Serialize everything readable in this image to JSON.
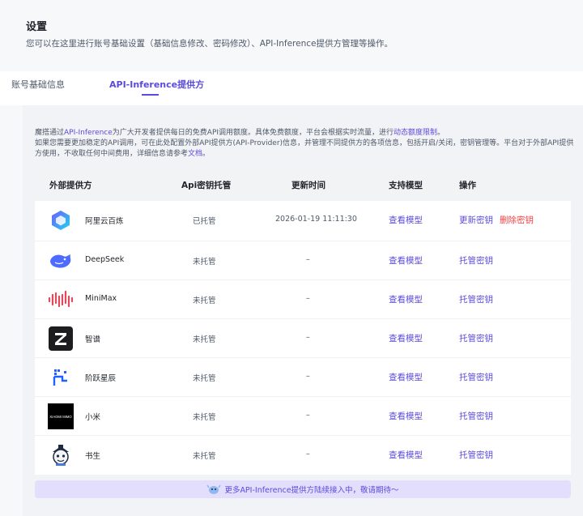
{
  "header": {
    "title": "设置",
    "description": "您可以在这里进行账号基础设置（基础信息修改、密码修改）、API-Inference提供方管理等操作。"
  },
  "tabs": [
    {
      "label": "账号基础信息",
      "active": false
    },
    {
      "label": "API-Inference提供方",
      "active": true
    }
  ],
  "intro": {
    "l1_a": "魔搭通过",
    "l1_link": "API-Inference",
    "l1_b": "为广大开发者提供每日的免费API调用额度。具体免费额度，平台会根据实时流量，进行",
    "l1_link2": "动态额度限制",
    "l1_c": "。",
    "l2": "如果您需要更加稳定的API调用，可在此处配置外部API提供方(API-Provider)信息，并管理不同提供方的各项信息，包括开启/关闭，密钥管理等。平台对于外部API提供方使用，不收取任何中间费用，详细信息请参考",
    "l2_link": "文档",
    "l2_end": "。"
  },
  "table": {
    "headers": [
      "外部提供方",
      "Api密钥托管",
      "更新时间",
      "支持模型",
      "操作"
    ],
    "rows": [
      {
        "provider": "阿里云百炼",
        "logo": "aliyun-bailian-icon",
        "status": "已托管",
        "updated": "2026-01-19 11:11:30",
        "model_link": "查看模型",
        "actions": [
          "更新密钥",
          "删除密钥"
        ]
      },
      {
        "provider": "DeepSeek",
        "logo": "deepseek-whale-icon",
        "status": "未托管",
        "updated": "–",
        "model_link": "查看模型",
        "actions": [
          "托管密钥"
        ]
      },
      {
        "provider": "MiniMax",
        "logo": "minimax-wave-icon",
        "status": "未托管",
        "updated": "–",
        "model_link": "查看模型",
        "actions": [
          "托管密钥"
        ]
      },
      {
        "provider": "智谱",
        "logo": "zhipu-z-icon",
        "status": "未托管",
        "updated": "–",
        "model_link": "查看模型",
        "actions": [
          "托管密钥"
        ]
      },
      {
        "provider": "阶跃星辰",
        "logo": "stepfun-icon",
        "status": "未托管",
        "updated": "–",
        "model_link": "查看模型",
        "actions": [
          "托管密钥"
        ]
      },
      {
        "provider": "小米",
        "logo": "xiaomi-mimo-icon",
        "status": "未托管",
        "updated": "–",
        "model_link": "查看模型",
        "actions": [
          "托管密钥"
        ]
      },
      {
        "provider": "书生",
        "logo": "shusheng-icon",
        "status": "未托管",
        "updated": "–",
        "model_link": "查看模型",
        "actions": [
          "托管密钥"
        ]
      }
    ]
  },
  "logo_text": {
    "xiaomi": "XIAOMI MIMO"
  },
  "banner": {
    "text": "更多API-Inference提供方陆续接入中，敬请期待～",
    "icon": "mascot-icon"
  },
  "colors": {
    "accent": "#5b4bdb",
    "danger": "#f53f3f",
    "background": "#f7f8fa"
  }
}
